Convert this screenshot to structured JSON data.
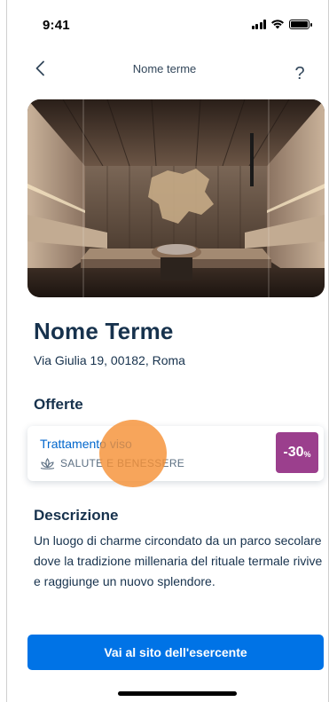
{
  "status_bar": {
    "time": "9:41",
    "icons": [
      "signal-icon",
      "wifi-icon",
      "battery-icon"
    ]
  },
  "header": {
    "title": "Nome terme",
    "back_icon": "chevron-left-icon",
    "help_label": "?"
  },
  "hero": {
    "description_icon": "sauna-photo"
  },
  "place": {
    "name": "Nome Terme",
    "address": "Via Giulia 19, 00182, Roma"
  },
  "offers": {
    "heading": "Offerte",
    "items": [
      {
        "name": "Trattamento viso",
        "category": "SALUTE E BENESSERE",
        "category_icon": "lotus-icon",
        "discount_value": "-30",
        "discount_unit": "%"
      }
    ]
  },
  "description": {
    "heading": "Descrizione",
    "text": "Un luogo di charme circondato da un parco secolare dove la tradizione millenaria del rituale termale rivive e raggiunge un nuovo splendore."
  },
  "cta": {
    "label": "Vai al sito dell'esercente"
  },
  "colors": {
    "primary_text": "#17324d",
    "link": "#0066cc",
    "accent": "#0073e6",
    "discount": "#9b3f8d",
    "touch": "#f59137"
  }
}
